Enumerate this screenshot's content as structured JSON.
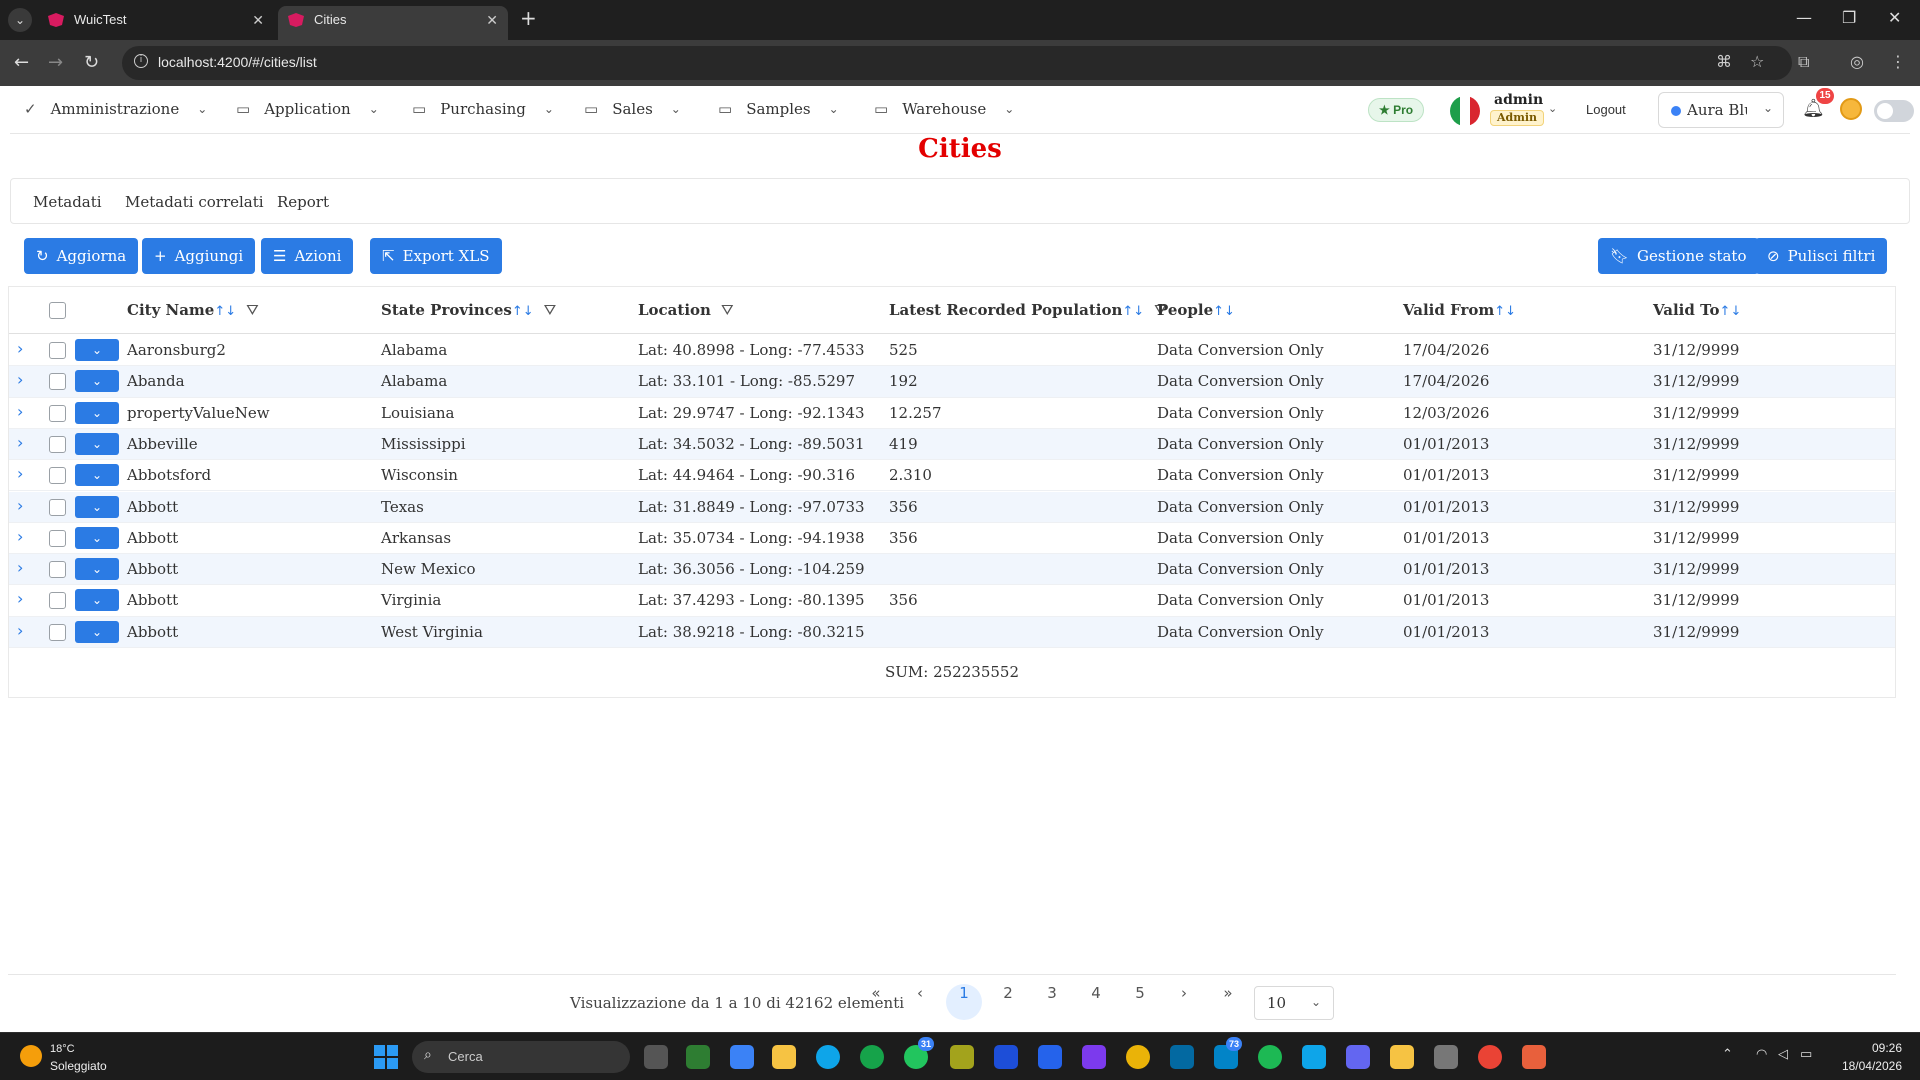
{
  "browser": {
    "tabs": [
      {
        "title": "WuicTest",
        "active": false
      },
      {
        "title": "Cities",
        "active": true
      }
    ],
    "url": "localhost:4200/#/cities/list"
  },
  "menu": {
    "items": [
      {
        "label": "Amministrazione",
        "icon": "check-icon"
      },
      {
        "label": "Application",
        "icon": "folder-icon"
      },
      {
        "label": "Purchasing",
        "icon": "folder-icon"
      },
      {
        "label": "Sales",
        "icon": "folder-icon"
      },
      {
        "label": "Samples",
        "icon": "folder-icon"
      },
      {
        "label": "Warehouse",
        "icon": "folder-icon"
      }
    ],
    "pro_badge": "Pro",
    "user_name": "admin",
    "user_role": "Admin",
    "logout": "Logout",
    "theme": "Aura Blue",
    "notifications": "15"
  },
  "page": {
    "title": "Cities",
    "subtabs": [
      "Metadati",
      "Metadati correlati",
      "Report"
    ]
  },
  "toolbar": {
    "refresh": "Aggiorna",
    "add": "Aggiungi",
    "actions": "Azioni",
    "export": "Export XLS",
    "state": "Gestione stato",
    "clear_filters": "Pulisci filtri"
  },
  "table": {
    "columns": [
      {
        "label": "City Name",
        "sortable": true,
        "filter": true
      },
      {
        "label": "State Provinces",
        "sortable": true,
        "filter": true
      },
      {
        "label": "Location",
        "sortable": false,
        "filter": true
      },
      {
        "label": "Latest Recorded Population",
        "sortable": true,
        "filter": true
      },
      {
        "label": "People",
        "sortable": true,
        "filter": false
      },
      {
        "label": "Valid From",
        "sortable": true,
        "filter": false
      },
      {
        "label": "Valid To",
        "sortable": true,
        "filter": false
      }
    ],
    "rows": [
      [
        "Aaronsburg2",
        "Alabama",
        "Lat: 40.8998 - Long: -77.4533",
        "525",
        "Data Conversion Only",
        "17/04/2026",
        "31/12/9999"
      ],
      [
        "Abanda",
        "Alabama",
        "Lat: 33.101 - Long: -85.5297",
        "192",
        "Data Conversion Only",
        "17/04/2026",
        "31/12/9999"
      ],
      [
        "propertyValueNew",
        "Louisiana",
        "Lat: 29.9747 - Long: -92.1343",
        "12.257",
        "Data Conversion Only",
        "12/03/2026",
        "31/12/9999"
      ],
      [
        "Abbeville",
        "Mississippi",
        "Lat: 34.5032 - Long: -89.5031",
        "419",
        "Data Conversion Only",
        "01/01/2013",
        "31/12/9999"
      ],
      [
        "Abbotsford",
        "Wisconsin",
        "Lat: 44.9464 - Long: -90.316",
        "2.310",
        "Data Conversion Only",
        "01/01/2013",
        "31/12/9999"
      ],
      [
        "Abbott",
        "Texas",
        "Lat: 31.8849 - Long: -97.0733",
        "356",
        "Data Conversion Only",
        "01/01/2013",
        "31/12/9999"
      ],
      [
        "Abbott",
        "Arkansas",
        "Lat: 35.0734 - Long: -94.1938",
        "356",
        "Data Conversion Only",
        "01/01/2013",
        "31/12/9999"
      ],
      [
        "Abbott",
        "New Mexico",
        "Lat: 36.3056 - Long: -104.259",
        "",
        "Data Conversion Only",
        "01/01/2013",
        "31/12/9999"
      ],
      [
        "Abbott",
        "Virginia",
        "Lat: 37.4293 - Long: -80.1395",
        "356",
        "Data Conversion Only",
        "01/01/2013",
        "31/12/9999"
      ],
      [
        "Abbott",
        "West Virginia",
        "Lat: 38.9218 - Long: -80.3215",
        "",
        "Data Conversion Only",
        "01/01/2013",
        "31/12/9999"
      ]
    ],
    "sum": "SUM: 252235552"
  },
  "pager": {
    "info": "Visualizzazione da 1 a 10 di 42162 elementi",
    "pages": [
      "1",
      "2",
      "3",
      "4",
      "5"
    ],
    "current": "1",
    "rows_per_page": "10"
  },
  "taskbar": {
    "temperature": "18°C",
    "weather": "Soleggiato",
    "search": "Cerca",
    "time": "09:26",
    "date": "18/04/2026",
    "badges": {
      "whatsapp": "31",
      "teams": "73"
    }
  }
}
